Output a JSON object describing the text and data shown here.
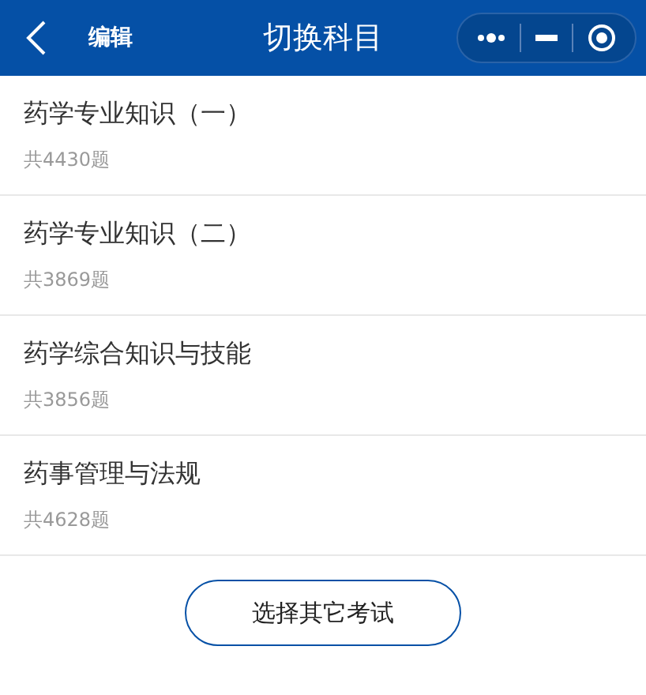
{
  "header": {
    "edit": "编辑",
    "title": "切换科目"
  },
  "subjects": [
    {
      "name": "药学专业知识（一）",
      "count": "共4430题"
    },
    {
      "name": "药学专业知识（二）",
      "count": "共3869题"
    },
    {
      "name": "药学综合知识与技能",
      "count": "共3856题"
    },
    {
      "name": "药事管理与法规",
      "count": "共4628题"
    }
  ],
  "other_button": "选择其它考试"
}
